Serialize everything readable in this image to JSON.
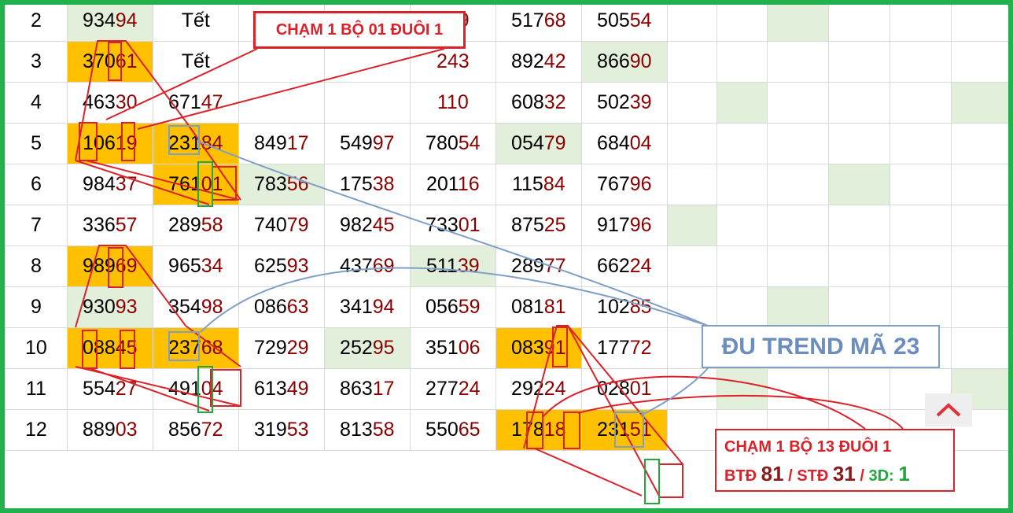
{
  "table": {
    "rows": [
      {
        "n": "2",
        "cells": [
          [
            "934",
            "94",
            "g"
          ],
          [
            "Tết",
            "",
            "w"
          ],
          [
            "",
            "",
            ""
          ],
          [
            "",
            "",
            ""
          ],
          [
            "",
            "479",
            ""
          ],
          [
            "517",
            "68",
            ""
          ],
          [
            "505",
            "54",
            ""
          ]
        ],
        "extra": [
          "",
          "",
          "g",
          "",
          "",
          ""
        ]
      },
      {
        "n": "3",
        "cells": [
          [
            "370",
            "61",
            "y"
          ],
          [
            "Tết",
            "",
            "w"
          ],
          [
            "",
            "",
            ""
          ],
          [
            "",
            "",
            ""
          ],
          [
            "",
            "243",
            ""
          ],
          [
            "892",
            "42",
            ""
          ],
          [
            "866",
            "90",
            "g"
          ]
        ],
        "extra": [
          "",
          "",
          "",
          "",
          "",
          ""
        ]
      },
      {
        "n": "4",
        "cells": [
          [
            "463",
            "30",
            ""
          ],
          [
            "671",
            "47",
            ""
          ],
          [
            "",
            "",
            ""
          ],
          [
            "",
            "",
            ""
          ],
          [
            "",
            "110",
            ""
          ],
          [
            "608",
            "32",
            ""
          ],
          [
            "502",
            "39",
            ""
          ]
        ],
        "extra": [
          "",
          "g",
          "",
          "",
          "",
          "g"
        ]
      },
      {
        "n": "5",
        "cells": [
          [
            "106",
            "19",
            "y"
          ],
          [
            "231",
            "84",
            "y"
          ],
          [
            "849",
            "17",
            ""
          ],
          [
            "549",
            "97",
            ""
          ],
          [
            "780",
            "54",
            ""
          ],
          [
            "054",
            "79",
            "g"
          ],
          [
            "684",
            "04",
            ""
          ]
        ],
        "extra": [
          "",
          "",
          "",
          "",
          "",
          ""
        ]
      },
      {
        "n": "6",
        "cells": [
          [
            "984",
            "37",
            ""
          ],
          [
            "761",
            "01",
            "y"
          ],
          [
            "783",
            "56",
            "g"
          ],
          [
            "175",
            "38",
            ""
          ],
          [
            "201",
            "16",
            ""
          ],
          [
            "115",
            "84",
            ""
          ],
          [
            "767",
            "96",
            ""
          ]
        ],
        "extra": [
          "",
          "",
          "",
          "g",
          "",
          ""
        ]
      },
      {
        "n": "7",
        "cells": [
          [
            "336",
            "57",
            ""
          ],
          [
            "289",
            "58",
            ""
          ],
          [
            "740",
            "79",
            ""
          ],
          [
            "982",
            "45",
            ""
          ],
          [
            "733",
            "01",
            ""
          ],
          [
            "875",
            "25",
            ""
          ],
          [
            "917",
            "96",
            ""
          ]
        ],
        "extra": [
          "g",
          "",
          "",
          "",
          "",
          ""
        ]
      },
      {
        "n": "8",
        "cells": [
          [
            "989",
            "69",
            "y"
          ],
          [
            "965",
            "34",
            ""
          ],
          [
            "625",
            "93",
            ""
          ],
          [
            "437",
            "69",
            ""
          ],
          [
            "511",
            "39",
            "g"
          ],
          [
            "289",
            "77",
            ""
          ],
          [
            "662",
            "24",
            ""
          ]
        ],
        "extra": [
          "",
          "",
          "",
          "",
          "",
          ""
        ]
      },
      {
        "n": "9",
        "cells": [
          [
            "930",
            "93",
            "g"
          ],
          [
            "354",
            "98",
            ""
          ],
          [
            "086",
            "63",
            ""
          ],
          [
            "341",
            "94",
            ""
          ],
          [
            "056",
            "59",
            ""
          ],
          [
            "081",
            "81",
            ""
          ],
          [
            "102",
            "85",
            ""
          ]
        ],
        "extra": [
          "",
          "",
          "g",
          "",
          "",
          ""
        ]
      },
      {
        "n": "10",
        "cells": [
          [
            "088",
            "45",
            "y"
          ],
          [
            "237",
            "68",
            "y"
          ],
          [
            "729",
            "29",
            ""
          ],
          [
            "252",
            "95",
            "g"
          ],
          [
            "351",
            "06",
            ""
          ],
          [
            "083",
            "91",
            "y"
          ],
          [
            "177",
            "72",
            ""
          ]
        ],
        "extra": [
          "",
          "",
          "",
          "",
          "",
          ""
        ]
      },
      {
        "n": "11",
        "cells": [
          [
            "554",
            "27",
            ""
          ],
          [
            "491",
            "04",
            ""
          ],
          [
            "613",
            "49",
            ""
          ],
          [
            "863",
            "17",
            ""
          ],
          [
            "277",
            "24",
            ""
          ],
          [
            "292",
            "24",
            ""
          ],
          [
            "028",
            "01",
            ""
          ]
        ],
        "extra": [
          "",
          "g",
          "",
          "",
          "",
          "g"
        ]
      },
      {
        "n": "12",
        "cells": [
          [
            "889",
            "03",
            ""
          ],
          [
            "856",
            "72",
            ""
          ],
          [
            "319",
            "53",
            ""
          ],
          [
            "813",
            "58",
            ""
          ],
          [
            "550",
            "65",
            ""
          ],
          [
            "178",
            "18",
            "y"
          ],
          [
            "231",
            "51",
            "y"
          ]
        ],
        "extra": [
          "",
          "",
          "",
          "",
          "",
          ""
        ]
      }
    ]
  },
  "annotations": {
    "top_label": "CHẠM 1 BỘ 01 ĐUÔI 1",
    "trend_label": "ĐU TREND MÃ 23",
    "bottom_line1": "CHẠM 1 BỘ 13 ĐUÔI 1",
    "btd_label": "BTĐ",
    "btd_value": "81",
    "std_label": "/ STĐ",
    "std_value": "31",
    "sep": "/",
    "d3_label": "3D:",
    "d3_value": "1"
  },
  "colors": {
    "highlight_yellow": "#ffc000",
    "highlight_green": "#e2efda",
    "red": "#d9222a",
    "blue": "#7f9fc6",
    "green": "#22b14c"
  }
}
